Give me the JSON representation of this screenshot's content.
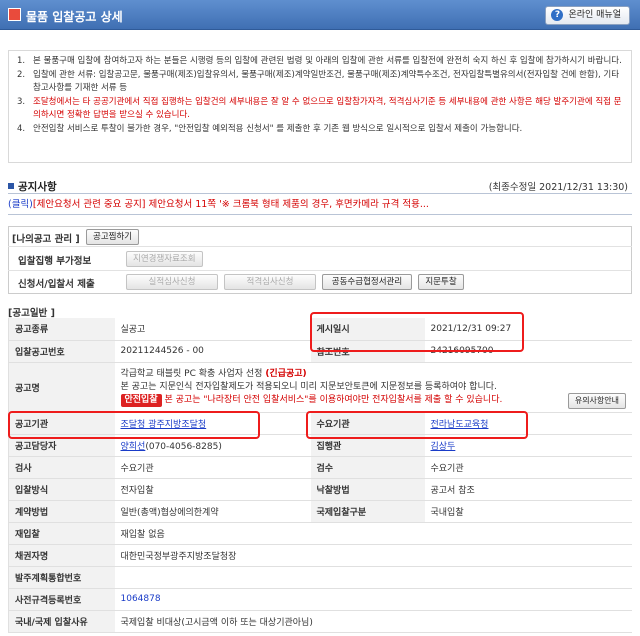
{
  "titlebar": {
    "title": "물품 입찰공고 상세",
    "manual_label": "온라인 매뉴얼"
  },
  "notice": {
    "items": [
      {
        "num": "1.",
        "text": "본 물품구매 입찰에 참여하고자 하는 분들은 시행령 등의 입찰에 관련된 법령 및 아래의 입찰에 관한 서류를 입찰전에 완전히 숙지 하신 후 입찰에 참가하시기 바랍니다."
      },
      {
        "num": "2.",
        "text": "입찰에 관한 서류: 입찰공고문, 물품구매(제조)입찰유의서, 물품구매(제조)계약일반조건, 물품구매(제조)계약특수조건, 전자입찰특별유의서(전자입찰 건에 한함), 기타 참고사항를 기재한 서류 등"
      },
      {
        "num": "3.",
        "text": "조달청에서는 타 공공기관에서 직접 집행하는 입찰건의 세부내용은 잘 알 수 없으므로 입찰참가자격, 적격심사기준 등 세부내용에 관한 사항은 해당 발주기관에 직접 문의하시면 정확한 답변을 받으실 수 있습니다."
      },
      {
        "num": "4.",
        "text": "안전입찰 서비스로 투찰이 불가한 경우, \"안전입찰 예외적용 신청서\" 를 제출한 후 기존 웹 방식으로 일시적으로 입찰서 제출이 가능합니다."
      }
    ]
  },
  "section": {
    "title": "공지사항",
    "updated": "(최종수정일 2021/12/31 13:30)"
  },
  "notice_line": {
    "prefix": "(클릭)",
    "text": "[제안요청서 관련 중요 공지] 제안요청서 11쪽 '※ 크롬북 형태 제품의 경우, 후면카메라 규격 적용..."
  },
  "my": {
    "label": "[나의공고 관리 ]",
    "mark_button": "공고찜하기",
    "row1_label": "입찰집행 부가정보",
    "row1_button": "지연경쟁자료조회",
    "row2_label": "신청서/입찰서 제출",
    "row2_buttons": [
      "실적심사신청",
      "적격심사신청",
      "공동수급협정서관리",
      "지문투찰"
    ]
  },
  "general": {
    "label": "[공고일반 ]",
    "type_label": "공고종류",
    "type_value": "실공고",
    "posted_label": "게시일시",
    "posted_value": "2021/12/31 09:27",
    "no_label": "입찰공고번호",
    "no_value": "20211244526 - 00",
    "ref_label": "참조번호",
    "ref_value": "24216095700",
    "name_label": "공고명",
    "name_line1": "각급학교 태블릿 PC 확충 사업자 선정",
    "name_tag": "(긴급공고)",
    "name_line2": "본 공고는 지문인식 전자입찰제도가 적용되오니 미리 지문보안토큰에 지문정보를 등록하여야 합니다.",
    "safe_badge": "안전입찰",
    "name_line3": "본 공고는 \"나라장터 안전 입찰서비스\"를 이용하여야만 전자입찰서를 제출 할 수 있습니다.",
    "safe_button": "유의사항안내",
    "org_label": "공고기관",
    "org_value": "조달청 광주지방조달청",
    "demand_label": "수요기관",
    "demand_value": "전라남도교육청",
    "mgr_label": "공고담당자",
    "mgr_name": "양희선",
    "mgr_phone": "(070-4056-8285)",
    "exec_label": "집행관",
    "exec_value": "김상두",
    "insp_label": "검사",
    "insp_value": "수요기관",
    "recv_label": "검수",
    "recv_value": "수요기관",
    "bidtype_label": "입찰방식",
    "bidtype_value": "전자입찰",
    "winner_label": "낙찰방법",
    "winner_value": "공고서 참조",
    "contract_label": "계약방법",
    "contract_value": "일반(총액)협상에의한계약",
    "intl_label": "국제입찰구분",
    "intl_value": "국내입찰",
    "rebid_label": "재입찰",
    "rebid_value": "재입찰 없음",
    "debtor_label": "채권자명",
    "debtor_value": "대한민국정부광주지방조달청장",
    "plan_label": "발주계획통합번호",
    "plan_value": "",
    "pre_label": "사전규격등록번호",
    "pre_value": "1064878",
    "reason_label": "국내/국제 입찰사유",
    "reason_value": "국제입찰 비대상(고시금액 이하 또는 대상기관아님)"
  }
}
